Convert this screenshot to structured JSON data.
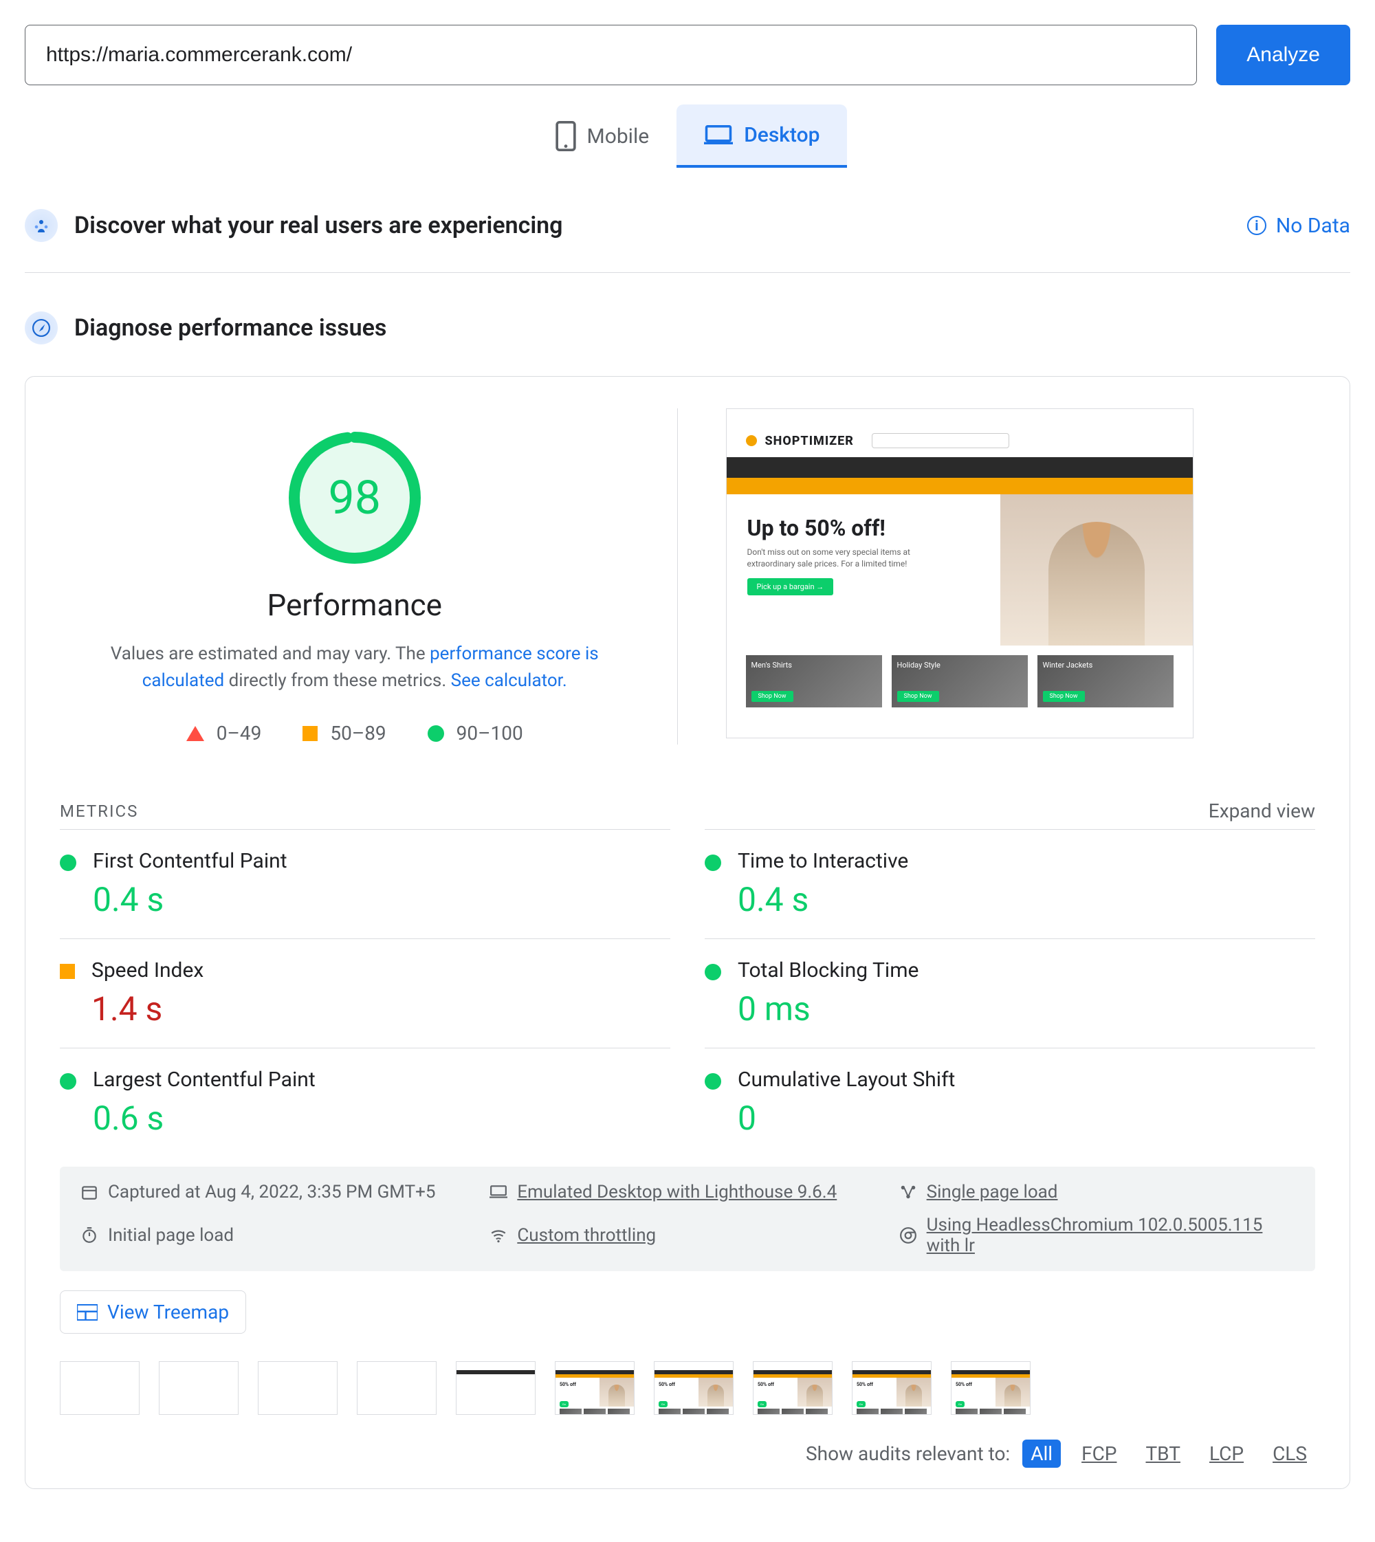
{
  "search": {
    "url": "https://maria.commercerank.com/",
    "analyze_label": "Analyze"
  },
  "tabs": {
    "mobile": "Mobile",
    "desktop": "Desktop"
  },
  "discover": {
    "title": "Discover what your real users are experiencing",
    "nodata": "No Data"
  },
  "diagnose": {
    "title": "Diagnose performance issues"
  },
  "score": {
    "value": "98",
    "label": "Performance",
    "desc_1": "Values are estimated and may vary. The ",
    "desc_link1": "performance score is calculated",
    "desc_2": " directly from these metrics. ",
    "desc_link2": "See calculator."
  },
  "legend": {
    "low": "0–49",
    "mid": "50–89",
    "high": "90–100"
  },
  "preview": {
    "brand": "SHOPTIMIZER",
    "hero_h": "Up to 50% off!",
    "hero_s": "Don't miss out on some very special items at extraordinary sale prices. For a limited time!",
    "hero_btn": "Pick up a bargain →",
    "card1": "Men's Shirts",
    "card2": "Holiday Style",
    "card3": "Winter Jackets",
    "shop_now": "Shop Now"
  },
  "metrics": {
    "heading": "METRICS",
    "expand": "Expand view",
    "items": [
      {
        "name": "First Contentful Paint",
        "value": "0.4 s",
        "status": "green",
        "vcolor": "green"
      },
      {
        "name": "Time to Interactive",
        "value": "0.4 s",
        "status": "green",
        "vcolor": "green"
      },
      {
        "name": "Speed Index",
        "value": "1.4 s",
        "status": "orange",
        "vcolor": "red"
      },
      {
        "name": "Total Blocking Time",
        "value": "0 ms",
        "status": "green",
        "vcolor": "green"
      },
      {
        "name": "Largest Contentful Paint",
        "value": "0.6 s",
        "status": "green",
        "vcolor": "green"
      },
      {
        "name": "Cumulative Layout Shift",
        "value": "0",
        "status": "green",
        "vcolor": "green"
      }
    ]
  },
  "info": {
    "captured": "Captured at Aug 4, 2022, 3:35 PM GMT+5",
    "emulated": "Emulated Desktop with Lighthouse 9.6.4",
    "single": "Single page load",
    "initial": "Initial page load",
    "throttling": "Custom throttling",
    "chrome": "Using HeadlessChromium 102.0.5005.115 with lr"
  },
  "treemap": "View Treemap",
  "audits": {
    "label": "Show audits relevant to:",
    "all": "All",
    "fcp": "FCP",
    "tbt": "TBT",
    "lcp": "LCP",
    "cls": "CLS"
  }
}
